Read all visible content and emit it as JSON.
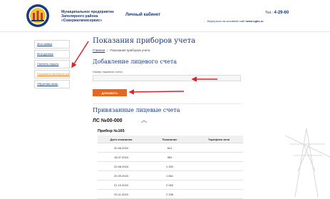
{
  "header": {
    "org_line1": "Муниципальное предприятие",
    "org_line2": "Заполярного района",
    "org_line3": "«Севержилкомсервис»",
    "cabinet_title": "Личный кабинет",
    "phone_prefix": "Тел.:",
    "phone_number": "4-29-60",
    "back_text": "Вернуться на основной сайт",
    "back_site": "www.sgks.ru"
  },
  "sidebar": {
    "items": [
      {
        "label": "Мои заявки"
      },
      {
        "label": "Мои данные"
      },
      {
        "label": "Сменить пароль"
      },
      {
        "label": "Показания приборов учета"
      },
      {
        "label": "Обратная связь"
      }
    ]
  },
  "main": {
    "page_title": "Показания приборов учета",
    "breadcrumb_home": "Главная",
    "breadcrumb_current": "Показания приборов учета",
    "add_section_title": "Добавление лицевого счета",
    "account_field_label": "Номер лицевого счета",
    "account_field_value": "",
    "add_button_label": "ДОБАВИТЬ",
    "linked_section_title": "Привязанные лицевые счета",
    "account_label": "ЛС №00-000",
    "device_label": "Прибор №165"
  },
  "table": {
    "headers": [
      "Дата показания",
      "Показание",
      "Тарифная зона"
    ],
    "rows": [
      [
        "20.06.2024",
        "641",
        ""
      ],
      [
        "18.07.2024",
        "964",
        ""
      ],
      [
        "20.08.2024",
        "1 302",
        ""
      ],
      [
        "20.09.2024",
        "1 861",
        ""
      ],
      [
        "21.10.2024",
        "2 062",
        ""
      ],
      [
        "20.11.2024",
        "2 336",
        ""
      ]
    ]
  },
  "colors": {
    "brand_blue": "#1a3a7a",
    "accent_orange": "#e8661e",
    "annotation_red": "#e0202a"
  }
}
